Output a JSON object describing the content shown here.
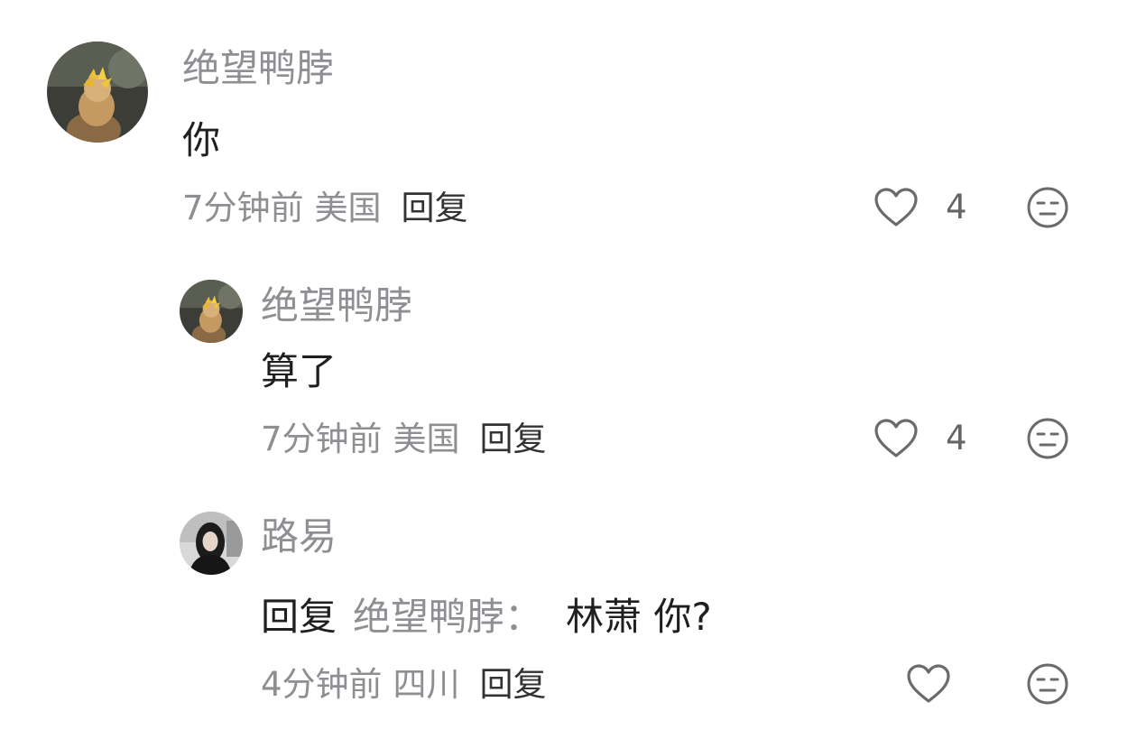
{
  "comments": [
    {
      "username": "绝望鸭脖",
      "text": "你",
      "time": "7分钟前",
      "location": "美国",
      "reply_label": "回复",
      "likes": "4",
      "avatar_icon": "cat-avatar"
    },
    {
      "username": "绝望鸭脖",
      "text": "算了",
      "time": "7分钟前",
      "location": "美国",
      "reply_label": "回复",
      "likes": "4",
      "avatar_icon": "cat-avatar"
    },
    {
      "username": "路易",
      "reply_prefix": "回复",
      "mention": "绝望鸭脖",
      "colon": "：",
      "text": "林萧  你?",
      "time": "4分钟前",
      "location": "四川",
      "reply_label": "回复",
      "avatar_icon": "girl-avatar"
    }
  ],
  "icons": {
    "like": "heart-outline-icon",
    "dislike": "unamused-face-icon"
  },
  "colors": {
    "username": "#8e8e93",
    "content": "#1f1f1f",
    "meta": "#8e8e93",
    "reply": "#333333",
    "icon": "#666666"
  }
}
